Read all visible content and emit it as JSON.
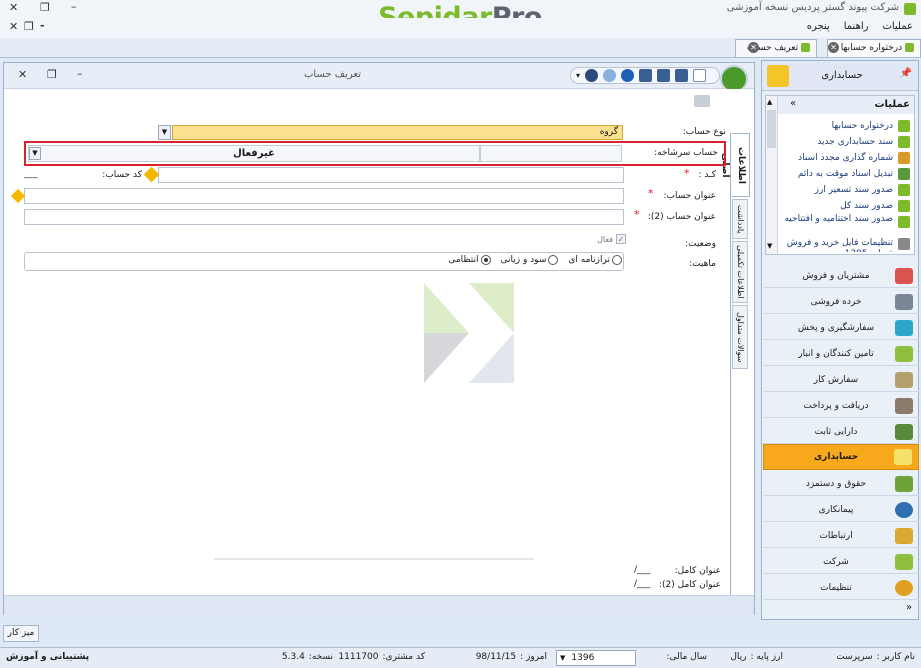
{
  "window": {
    "title": "شرکت پیوند گستر پردیس نسخه آموزشی",
    "logo_part1": "Sepidar",
    "logo_part2": "Pro"
  },
  "menu": {
    "items": [
      "عملیات",
      "راهنما",
      "پنجره"
    ]
  },
  "tabs": [
    {
      "label": "درختواره حسابها"
    },
    {
      "label": "تعریف حساب"
    }
  ],
  "doc": {
    "title": "تعریف حساب",
    "side_tabs": [
      "اطلاعات اصلی",
      "یادداشت",
      "اطلاعات تکمیلی",
      "سوالات متداول"
    ],
    "account_type_label": "نوع حساب:",
    "account_type_value": "گروه",
    "parent_label": "حساب سرشاخه:",
    "parent_value": "غیرفعال",
    "code_label": "کـد :",
    "code_star": "*",
    "code_hint": "کد حساب:",
    "code_line": "___",
    "title_label": "عنوان حساب:",
    "title2_label": "عنوان حساب (2):",
    "status_label": "وضعیت:",
    "status_active": "فعال",
    "nature_label": "ماهیت:",
    "nature_options": [
      "ترازنامه ای",
      "سود و زیانی",
      "انتظامی"
    ],
    "fulltitle_label": "عنوان کامل:",
    "fulltitle2_label": "عنوان کامل (2):",
    "fulltitle_value": "/___",
    "fulltitle2_value": "/___"
  },
  "sidebar": {
    "header": "حسابداری",
    "ops_title": "عملیات",
    "ops": [
      "درختواره حسابها",
      "سند حسابداری جدید",
      "شماره گذاری مجدد اسناد",
      "تبدیل اسناد موقت به دائم",
      "صدور سند تسعیر ارز",
      "صدور سند کل",
      "صدور سند اختتامیه و افتتاحیه",
      "تنظیمات فایل خرید و فروش فصلی 1395"
    ],
    "modules": [
      "مشتریان و فروش",
      "خرده فروشی",
      "سفارشگیری و پخش",
      "تامین کنندگان و انبار",
      "سفارش کار",
      "دریافت و پرداخت",
      "دارایی ثابت",
      "حسابداری",
      "حقوق و دستمزد",
      "پیمانکاری",
      "ارتباطات",
      "شرکت",
      "تنظیمات"
    ]
  },
  "desk_tab": "میز کار",
  "status": {
    "user_label": "نام کاربر :",
    "user_value": "سرپرست",
    "currency_label": "ارز پایه :",
    "currency_value": "ریال",
    "fiscal_label": "سال مالی:",
    "fiscal_value": "1396",
    "today_label": "امروز :",
    "today_value": "98/11/15",
    "customer_label": "کد مشتری:",
    "customer_value": "1111700",
    "version_label": "نسخه:",
    "version_value": "5.3.4",
    "support": "پشتیبانی و آموزش"
  },
  "colors": {
    "accent_green": "#7dbb2c",
    "logo_grey": "#5d6470",
    "highlight_red": "#d6232f",
    "selected_module": "#f7a81b",
    "account_type_fill": "#fbe08d"
  }
}
